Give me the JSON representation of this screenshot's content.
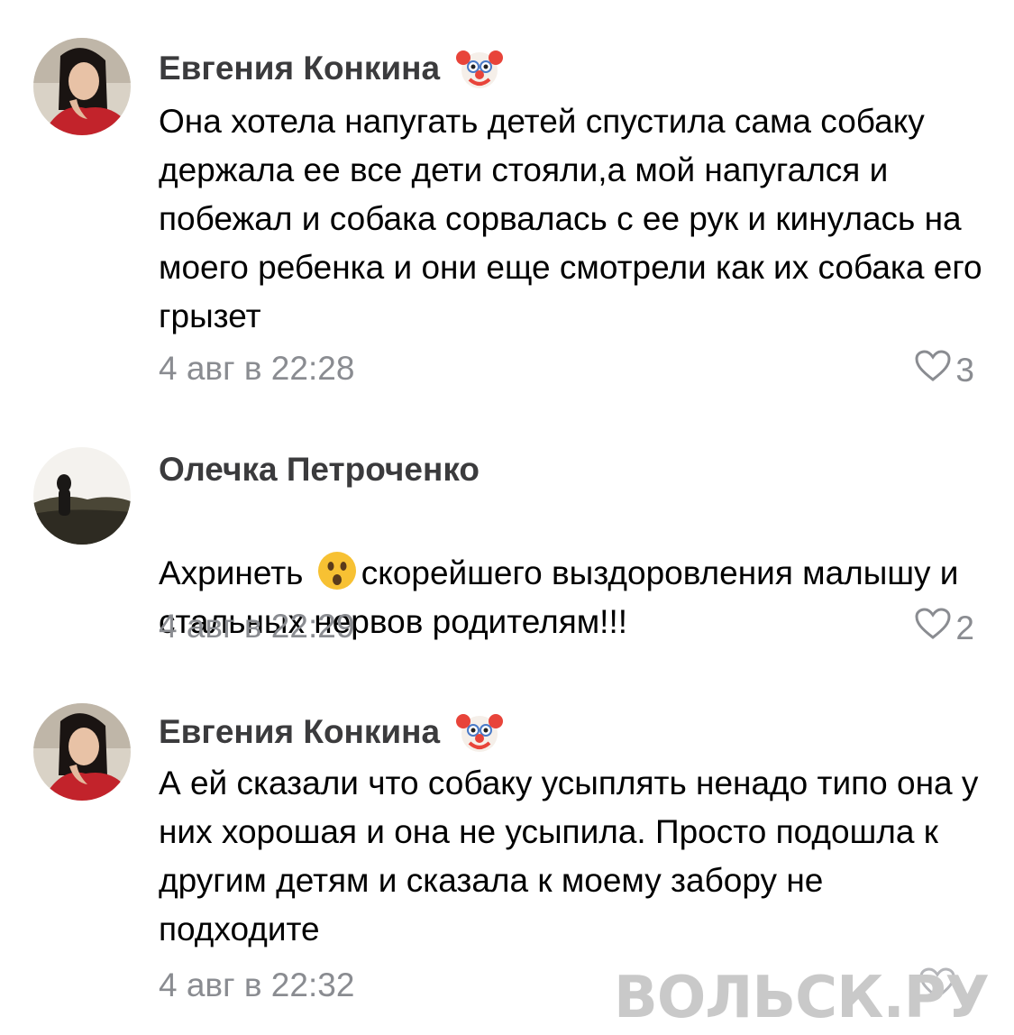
{
  "comments": [
    {
      "author": "Евгения Конкина",
      "author_emoji": "clown-face-icon",
      "text": "Она хотела напугать детей спустила сама собаку держала ее все дети стояли,а мой напугался и побежал и собака сорвалась с ее рук и кинулась на моего ребенка и они еще смотрели как их собака его грызет",
      "time": "4 авг в 22:28",
      "likes": "3"
    },
    {
      "author": "Олечка Петроченко",
      "text_before": "Ахринеть ",
      "text_emoji": "astonished-face-icon",
      "text_after": "скорейшего выздоровления малышу и стальных нервов родителям!!!",
      "time": "4 авг в 22:29",
      "likes": "2"
    },
    {
      "author": "Евгения Конкина",
      "author_emoji": "clown-face-icon",
      "text": "А ей сказали что собаку усыплять ненадо типо она у них хорошая и она не усыпила. Просто подошла к другим детям и сказала к моему забору не подходите",
      "time": "4 авг в 22:32"
    }
  ],
  "watermark": "ВОЛЬСК.РУ",
  "colors": {
    "author": "#3b3b3d",
    "meta": "#8a8c91",
    "watermark": "#c9c9c9"
  }
}
